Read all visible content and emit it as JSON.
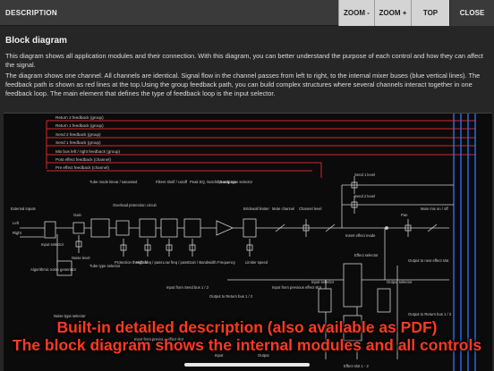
{
  "topbar": {
    "title": "DESCRIPTION",
    "zoom_out": "ZOOM -",
    "zoom_in": "ZOOM +",
    "top": "TOP",
    "close": "CLOSE"
  },
  "content": {
    "heading": "Block diagram",
    "para1": "This diagram shows all application modules and their connection. With this diagram, you can better understand the purpose of each control and how they can affect the signal.",
    "para2": "The diagram shows one channel. All channels are identical. Signal flow in the channel passes from left to right, to the internal mixer buses (blue vertical lines). The feedback path is shown as red lines at the top.Using the group feedback path, you can build complex structures where several channels interact together in one feedback loop. The main element that defines the type of feedback loop is the input selector."
  },
  "diagram": {
    "feedback": [
      "Return 2 feedback (group)",
      "Return 1 feedback (group)",
      "Send 2 feedback (group)",
      "Send 1 feedback (group)",
      "Mix bus left / right feedback (group)",
      "Post effect feedback (channel)",
      "Pre effect feedback (channel)"
    ],
    "labels": {
      "external_inputs": "External inputs",
      "left": "Left",
      "right": "Right",
      "input_selector": "Input selector",
      "gain": "Gain",
      "noise_level": "Noise level",
      "tube_mode": "Tube mode linear / saturated",
      "tube_type": "Tube type selector",
      "overload": "Overload protection circuit",
      "protection": "Protection threshold",
      "filters": "Filters shelf / cutoff",
      "peak_eq": "Peak EQ, Notch / Bandpass",
      "opamp": "Op-amp type selector",
      "high_pass": "High freq / pass",
      "low_pass": "Low freq / pass",
      "bandwidth": "Gain / Bandwidth Frequency",
      "brickwall": "Brickwall limiter",
      "limiter_speed": "Limiter speed",
      "mute": "Mute channel",
      "channel_level": "Channel level",
      "send1": "Send 1 level",
      "send2": "Send 2 level",
      "insert_effect": "Insert effect mode",
      "pan": "Pan",
      "main_mix": "Main mix on / off",
      "algorithmic": "Algorithmic noise generator",
      "noise_type": "Noise type selector",
      "effect_selector": "Effect selector",
      "input_from_send": "Input from Send bus 1 / 2",
      "output_to_return": "Output to Return bus 1 / 2",
      "input_from_prev": "Input from previous effect slot",
      "input_selector2": "Input selector",
      "output_selector": "Output selector",
      "output_to_next": "Output to next effect slot",
      "output_to_return2": "Output to Return bus 1 / 2",
      "effect_slot": "Effect slot 1 - 2",
      "input_from_prev2": "Input from previous effect slot",
      "input": "Input",
      "output": "Output"
    }
  },
  "captions": {
    "line1": "Built-in detailed description (also available as PDF)",
    "line2": "The block diagram shows the internal modules and all controls"
  }
}
